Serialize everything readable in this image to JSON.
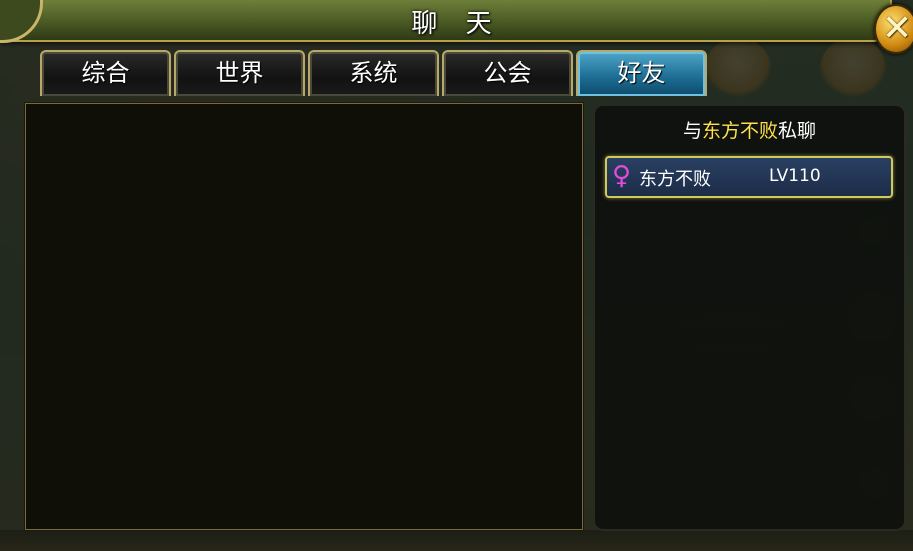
{
  "window": {
    "title": "聊 天",
    "close_icon": "close-x-icon",
    "accent_color": "#b9a04a"
  },
  "tabs": [
    {
      "label": "综合",
      "active": false
    },
    {
      "label": "世界",
      "active": false
    },
    {
      "label": "系统",
      "active": false
    },
    {
      "label": "公会",
      "active": false
    },
    {
      "label": "好友",
      "active": true
    }
  ],
  "private_chat": {
    "prefix": "与",
    "target_name": "东方不败",
    "suffix": "私聊",
    "highlight_color": "#ffe34a"
  },
  "friends": [
    {
      "gender_icon": "female-icon",
      "gender_symbol": "♀",
      "name": "东方不败",
      "level": "LV110",
      "selected": true
    }
  ]
}
